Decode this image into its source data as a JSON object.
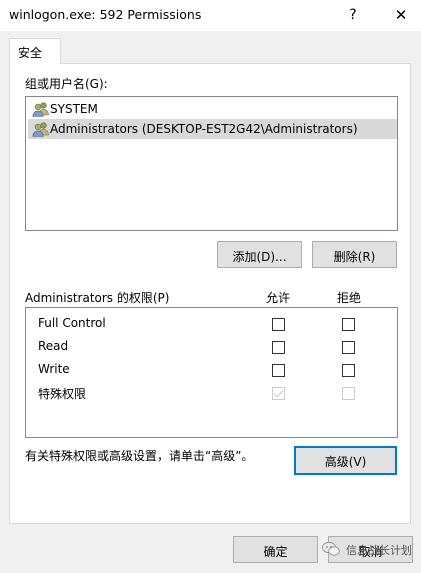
{
  "window": {
    "title": "winlogon.exe: 592 Permissions",
    "help_label": "?",
    "close_label": "✕"
  },
  "tabs": [
    {
      "label": "安全",
      "active": true
    }
  ],
  "security": {
    "group_label": "组或用户名(G):",
    "principals": [
      {
        "name": "SYSTEM",
        "icon": "users-icon",
        "selected": false
      },
      {
        "name": "Administrators (DESKTOP-EST2G42\\Administrators)",
        "icon": "users-icon",
        "selected": true
      }
    ],
    "add_button": "添加(D)...",
    "remove_button": "删除(R)",
    "permissions_label": "Administrators 的权限(P)",
    "allow_header": "允许",
    "deny_header": "拒绝",
    "permissions": [
      {
        "name": "Full Control",
        "allow": false,
        "deny": false,
        "disabled": false
      },
      {
        "name": "Read",
        "allow": false,
        "deny": false,
        "disabled": false
      },
      {
        "name": "Write",
        "allow": false,
        "deny": false,
        "disabled": false
      },
      {
        "name": "特殊权限",
        "allow": true,
        "deny": false,
        "disabled": true
      }
    ],
    "advanced_hint": "有关特殊权限或高级设置，请单击“高级”。",
    "advanced_button": "高级(V)"
  },
  "footer": {
    "ok_button": "确定",
    "cancel_button": "取消"
  },
  "watermark": {
    "text": "信息战长计划"
  },
  "colors": {
    "accent": "#0078d7",
    "selection": "#d9d9d9",
    "dialog_bg": "#f0f0f0"
  }
}
